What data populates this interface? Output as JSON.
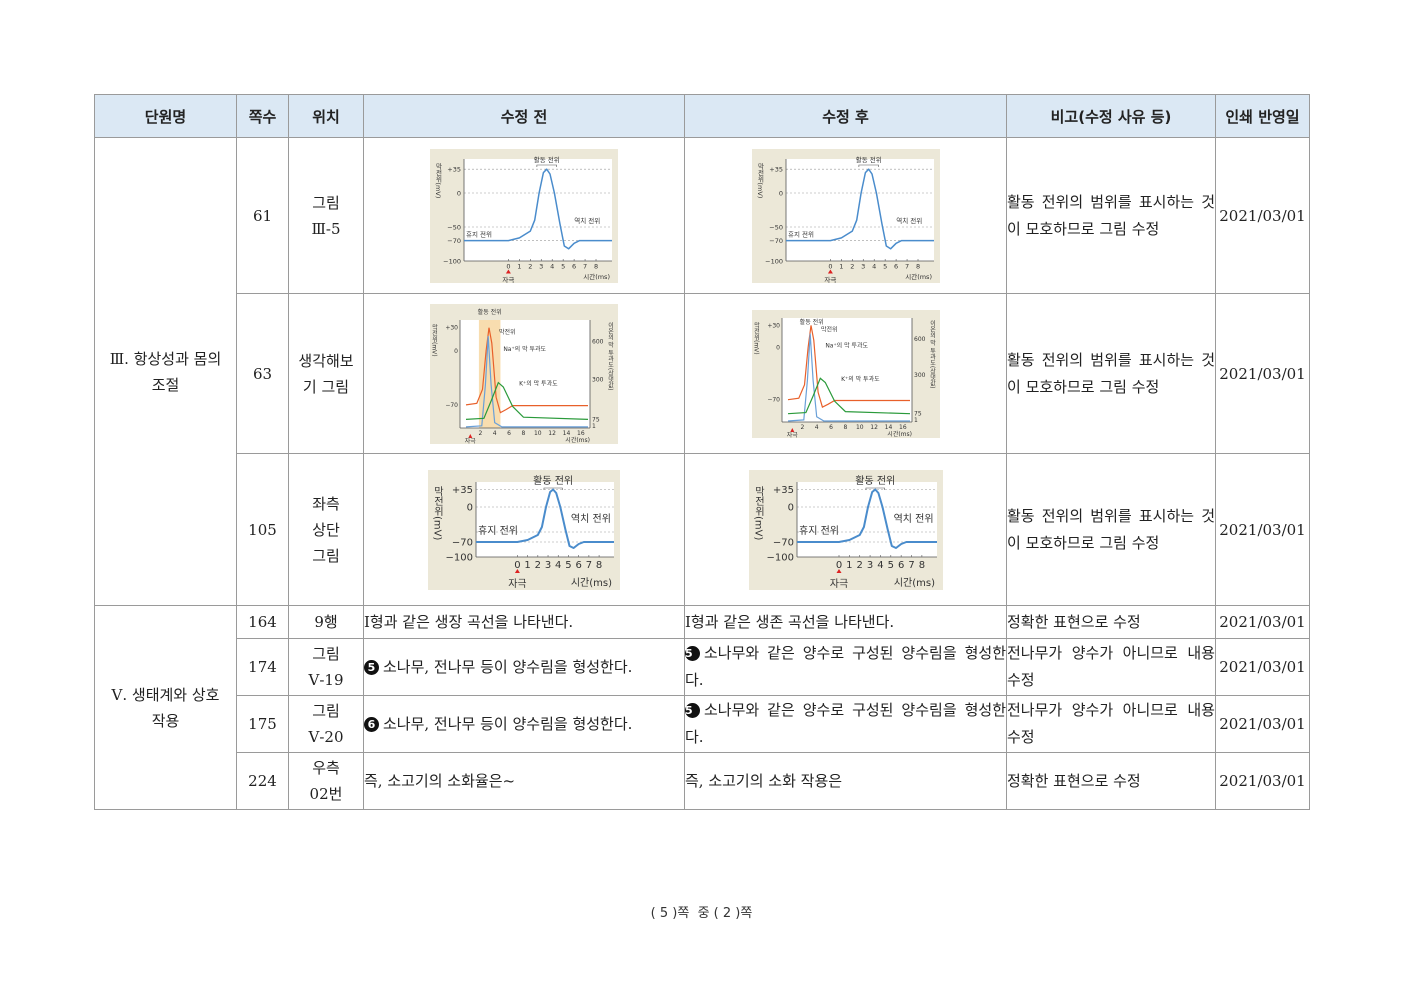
{
  "table": {
    "headers": [
      "단원명",
      "쪽수",
      "위치",
      "수정 전",
      "수정 후",
      "비고(수정 사유 등)",
      "인쇄 반영일"
    ],
    "unit3": "Ⅲ. 항상성과 몸의 조절",
    "unit5": "Ⅴ. 생태계와 상호 작용",
    "rows": [
      {
        "page": "61",
        "pos": "그림 Ⅲ-5",
        "note": "활동 전위의 범위를 표시하는 것이 모호하므로 그림 수정",
        "date": "2021/03/01"
      },
      {
        "page": "63",
        "pos": "생각해보기 그림",
        "note": "활동 전위의 범위를 표시하는 것이 모호하므로 그림 수정",
        "date": "2021/03/01"
      },
      {
        "page": "105",
        "pos": "좌측 상단 그림",
        "note": "활동 전위의 범위를 표시하는 것이 모호하므로 그림 수정",
        "date": "2021/03/01"
      },
      {
        "page": "164",
        "pos": "9행",
        "before": "I형과 같은 생장 곡선을 나타낸다.",
        "after": "I형과 같은 생존 곡선을 나타낸다.",
        "note": "정확한 표현으로 수정",
        "date": "2021/03/01"
      },
      {
        "page": "174",
        "pos": "그림 Ⅴ-19",
        "before_mark": "5",
        "before": "소나무, 전나무 등이 양수림을 형성한다.",
        "after_mark": "5",
        "after": "소나무와 같은 양수로 구성된 양수림을 형성한다.",
        "note": "전나무가 양수가 아니므로 내용 수정",
        "date": "2021/03/01"
      },
      {
        "page": "175",
        "pos": "그림 Ⅴ-20",
        "before_mark": "6",
        "before": "소나무, 전나무 등이 양수림을 형성한다.",
        "after_mark": "5",
        "after": "소나무와 같은 양수로 구성된 양수림을 형성한다.",
        "note": "전나무가 양수가 아니므로 내용 수정",
        "date": "2021/03/01"
      },
      {
        "page": "224",
        "pos": "우측 02번",
        "before": "즉, 소고기의 소화율은~",
        "after": "즉, 소고기의 소화 작용은",
        "note": "정확한 표현으로 수정",
        "date": "2021/03/01"
      }
    ]
  },
  "figures": {
    "ap": {
      "ylabel": "막전위(mV)",
      "yticks": [
        "+35",
        "0",
        "−50",
        "−70",
        "−100"
      ],
      "xticks": [
        "0",
        "1",
        "2",
        "3",
        "4",
        "5",
        "6",
        "7",
        "8"
      ],
      "xlabel": "시간(ms)",
      "stimulus": "자극",
      "peak_label": "활동 전위",
      "rest_label": "휴지 전위",
      "threshold_label": "역치 전위"
    },
    "ion": {
      "ylabel": "막전위(mV)",
      "yticks": [
        "+30",
        "0",
        "−70"
      ],
      "y2label": "이온의 막 투과도(상댓값)",
      "y2ticks": [
        "600",
        "300",
        "75",
        "1"
      ],
      "xticks": [
        "2",
        "4",
        "6",
        "8",
        "10",
        "12",
        "14",
        "16"
      ],
      "xlabel": "시간(ms)",
      "stimulus": "자극",
      "peak_label": "활동 전위",
      "membrane_label": "막전위",
      "na_label": "Na⁺의 막 투과도",
      "k_label": "K⁺의 막 투과도"
    },
    "colors": {
      "ap_line": "#4a8ccc",
      "na_line": "#e8602a",
      "k_line": "#2a9a3a",
      "ion_line": "#6aa0d8",
      "panel_bg": "#ece8d8",
      "plot_bg": "#ffffff",
      "highlight": "#f7d9a6"
    }
  },
  "footer": {
    "current": "5",
    "text_mid": "쪽  중",
    "total": "2",
    "text_end": "쪽"
  }
}
